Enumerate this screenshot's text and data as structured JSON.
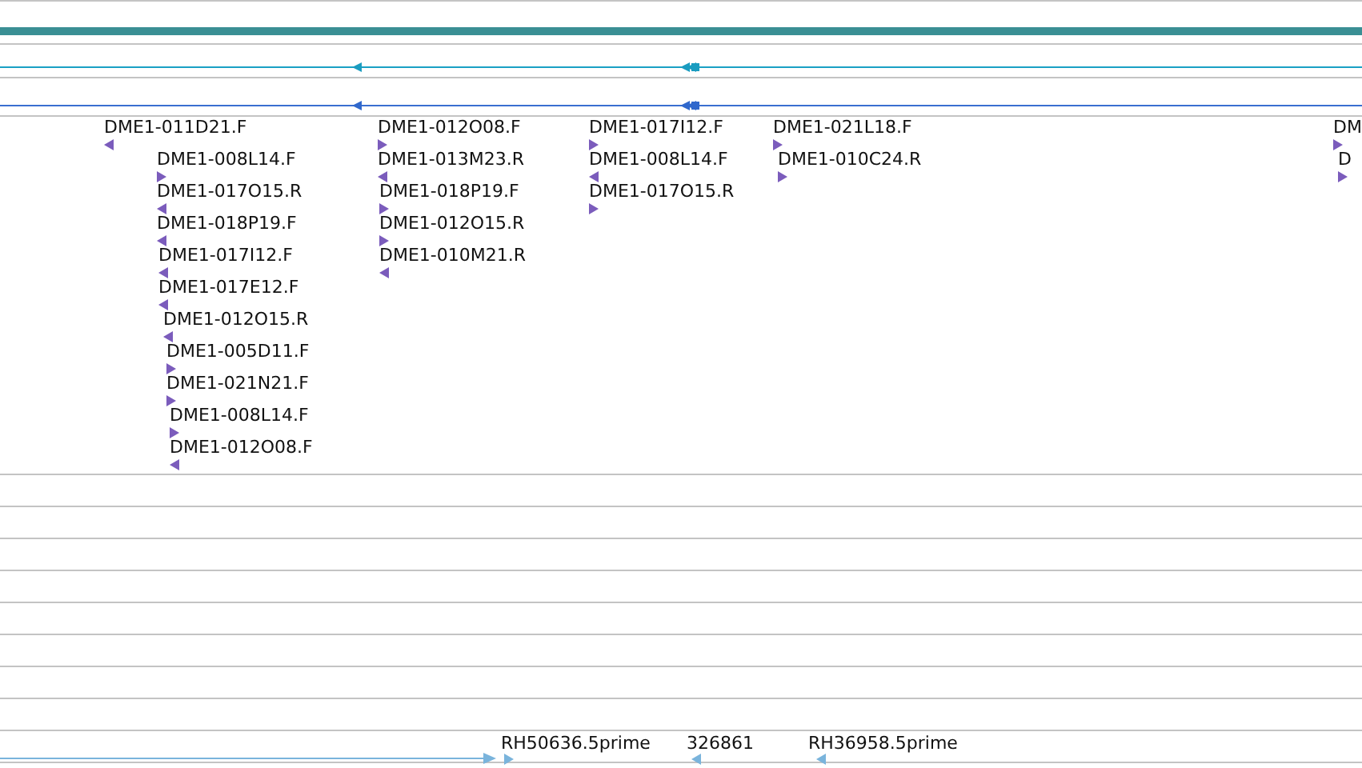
{
  "clone_columns": [
    [
      {
        "label": "DME1-011D21.F",
        "reverse": true
      },
      {
        "label": "DME1-008L14.F",
        "reverse": false
      },
      {
        "label": "DME1-017O15.R",
        "reverse": true
      },
      {
        "label": "DME1-018P19.F",
        "reverse": true
      },
      {
        "label": "DME1-017I12.F",
        "reverse": true
      },
      {
        "label": "DME1-017E12.F",
        "reverse": true
      },
      {
        "label": "DME1-012O15.R",
        "reverse": true
      },
      {
        "label": "DME1-005D11.F",
        "reverse": false
      },
      {
        "label": "DME1-021N21.F",
        "reverse": false
      },
      {
        "label": "DME1-008L14.F",
        "reverse": false
      },
      {
        "label": "DME1-012O08.F",
        "reverse": true
      }
    ],
    [
      {
        "label": "DME1-012O08.F",
        "reverse": false
      },
      {
        "label": "DME1-013M23.R",
        "reverse": true
      },
      {
        "label": "DME1-018P19.F",
        "reverse": false
      },
      {
        "label": "DME1-012O15.R",
        "reverse": false
      },
      {
        "label": "DME1-010M21.R",
        "reverse": true
      }
    ],
    [
      {
        "label": "DME1-017I12.F",
        "reverse": false
      },
      {
        "label": "DME1-008L14.F",
        "reverse": true
      },
      {
        "label": "DME1-017O15.R",
        "reverse": false
      }
    ],
    [
      {
        "label": "DME1-021L18.F",
        "reverse": false
      },
      {
        "label": "DME1-010C24.R",
        "reverse": false
      }
    ],
    [
      {
        "label": "DM",
        "reverse": false
      },
      {
        "label": "D",
        "reverse": false
      }
    ]
  ],
  "est_features": [
    {
      "label": "RH50636.5prime",
      "reverse": false
    },
    {
      "label": "326861",
      "reverse": true
    },
    {
      "label": "RH36958.5prime",
      "reverse": true
    }
  ]
}
